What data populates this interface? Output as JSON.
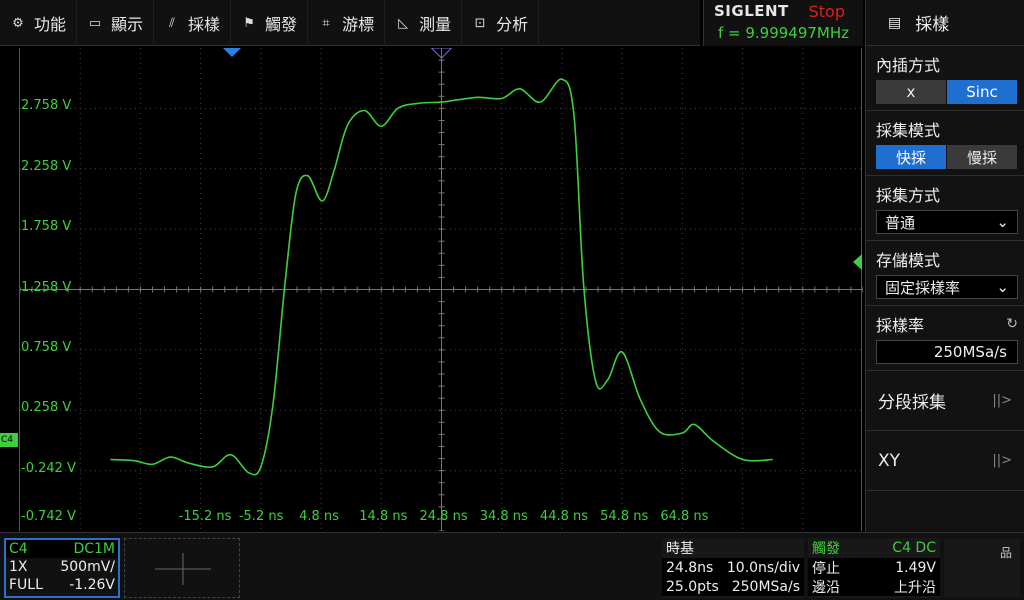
{
  "menu": [
    {
      "name": "menu-function",
      "icon": "gear-icon",
      "glyph": "⚙",
      "label": "功能"
    },
    {
      "name": "menu-display",
      "icon": "monitor-icon",
      "glyph": "▭",
      "label": "顯示"
    },
    {
      "name": "menu-acquire",
      "icon": "sample-icon",
      "glyph": "⫽",
      "label": "採樣"
    },
    {
      "name": "menu-trigger",
      "icon": "flag-icon",
      "glyph": "⚑",
      "label": "觸發"
    },
    {
      "name": "menu-cursor",
      "icon": "crosshair-icon",
      "glyph": "⌗",
      "label": "游標"
    },
    {
      "name": "menu-measure",
      "icon": "ruler-icon",
      "glyph": "◺",
      "label": "測量"
    },
    {
      "name": "menu-analyze",
      "icon": "analyze-icon",
      "glyph": "⊡",
      "label": "分析"
    }
  ],
  "brand": {
    "logo": "SIGLENT",
    "status": "Stop",
    "frequency": "f = 9.999497MHz"
  },
  "panel": {
    "title": "採樣",
    "interp": {
      "label": "內插方式",
      "options": [
        "x",
        "Sinc"
      ],
      "selected": 1
    },
    "mode": {
      "label": "採集模式",
      "options": [
        "快採",
        "慢採"
      ],
      "selected": 0
    },
    "acq": {
      "label": "採集方式",
      "value": "普通"
    },
    "memory": {
      "label": "存儲模式",
      "value": "固定採樣率"
    },
    "rate": {
      "label": "採樣率",
      "value": "250MSa/s"
    },
    "segmented": "分段採集",
    "xy": "XY"
  },
  "grid": {
    "ylabels": [
      "2.758 V",
      "2.258 V",
      "1.758 V",
      "1.258 V",
      "0.758 V",
      "0.258 V",
      "-0.242 V",
      "-0.742 V"
    ],
    "xlabels": [
      "-15.2 ns",
      "-5.2 ns",
      "4.8 ns",
      "14.8 ns",
      "24.8 ns",
      "34.8 ns",
      "44.8 ns",
      "54.8 ns",
      "64.8 ns"
    ],
    "channel_marker": "C4",
    "trace_color": "#3ecf3e"
  },
  "waveform": [
    [
      -30.2,
      -0.15
    ],
    [
      -26.2,
      -0.16
    ],
    [
      -23.2,
      -0.19
    ],
    [
      -20.2,
      -0.13
    ],
    [
      -17.2,
      -0.18
    ],
    [
      -13.2,
      -0.21
    ],
    [
      -10.2,
      -0.11
    ],
    [
      -7.2,
      -0.26
    ],
    [
      -5.2,
      -0.21
    ],
    [
      -3.2,
      0.3
    ],
    [
      -1.2,
      1.3
    ],
    [
      0.6,
      2.05
    ],
    [
      2.6,
      2.2
    ],
    [
      5.0,
      1.99
    ],
    [
      7.0,
      2.25
    ],
    [
      9.2,
      2.62
    ],
    [
      12.0,
      2.74
    ],
    [
      14.8,
      2.61
    ],
    [
      17.6,
      2.76
    ],
    [
      21.0,
      2.8
    ],
    [
      24.8,
      2.81
    ],
    [
      27.6,
      2.83
    ],
    [
      31.0,
      2.85
    ],
    [
      34.8,
      2.84
    ],
    [
      37.8,
      2.92
    ],
    [
      41.2,
      2.81
    ],
    [
      44.8,
      3.0
    ],
    [
      46.8,
      2.7
    ],
    [
      48.4,
      1.3
    ],
    [
      50.4,
      0.5
    ],
    [
      52.4,
      0.51
    ],
    [
      54.8,
      0.74
    ],
    [
      57.8,
      0.35
    ],
    [
      61.0,
      0.08
    ],
    [
      64.8,
      0.07
    ],
    [
      66.8,
      0.14
    ],
    [
      70.0,
      0.0
    ],
    [
      74.8,
      -0.15
    ],
    [
      79.8,
      -0.15
    ]
  ],
  "bottom": {
    "channel": {
      "name": "C4",
      "coupling": "DC1M",
      "probe": "1X",
      "scale": "500mV/",
      "bandwidth": "FULL",
      "offset": "-1.26V"
    },
    "timebase": {
      "title": "時基",
      "delay": "24.8ns",
      "scale": "10.0ns/div",
      "points": "25.0pts",
      "rate": "250MSa/s"
    },
    "trigger": {
      "title": "觸發",
      "source": "C4 DC",
      "mode": "停止",
      "level": "1.49V",
      "type": "邊沿",
      "slope": "上升沿"
    }
  }
}
